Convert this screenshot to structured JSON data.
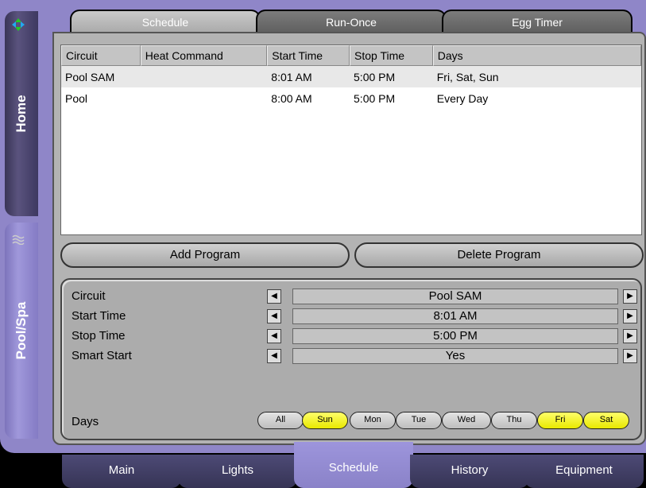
{
  "top_tabs": [
    {
      "label": "Schedule",
      "active": true
    },
    {
      "label": "Run-Once",
      "active": false
    },
    {
      "label": "Egg Timer",
      "active": false
    }
  ],
  "side_tabs": [
    {
      "label": "Home",
      "icon": "green-arrows-icon"
    },
    {
      "label": "Pool/Spa",
      "icon": "pool-icon"
    }
  ],
  "table": {
    "columns": [
      "Circuit",
      "Heat Command",
      "Start Time",
      "Stop Time",
      "Days"
    ],
    "rows": [
      {
        "circuit": "Pool SAM",
        "heat": "",
        "start": "8:01  AM",
        "stop": "5:00  PM",
        "days": "Fri, Sat, Sun",
        "selected": true
      },
      {
        "circuit": "Pool",
        "heat": "",
        "start": "8:00  AM",
        "stop": "5:00  PM",
        "days": "Every Day",
        "selected": false
      }
    ]
  },
  "buttons": {
    "add_program": "Add Program",
    "delete_program": "Delete Program"
  },
  "settings": {
    "circuit": {
      "label": "Circuit",
      "value": "Pool SAM"
    },
    "start_time": {
      "label": "Start Time",
      "value": "8:01  AM"
    },
    "stop_time": {
      "label": "Stop Time",
      "value": "5:00  PM"
    },
    "smart_start": {
      "label": "Smart Start",
      "value": "Yes"
    }
  },
  "days": {
    "label": "Days",
    "buttons": [
      {
        "label": "All",
        "on": false
      },
      {
        "label": "Sun",
        "on": true
      },
      {
        "label": "Mon",
        "on": false
      },
      {
        "label": "Tue",
        "on": false
      },
      {
        "label": "Wed",
        "on": false
      },
      {
        "label": "Thu",
        "on": false
      },
      {
        "label": "Fri",
        "on": true
      },
      {
        "label": "Sat",
        "on": true
      }
    ]
  },
  "bottom_nav": [
    {
      "label": "Main",
      "active": false
    },
    {
      "label": "Lights",
      "active": false
    },
    {
      "label": "Schedule",
      "active": true
    },
    {
      "label": "History",
      "active": false
    },
    {
      "label": "Equipment",
      "active": false
    }
  ],
  "colors": {
    "frame": "#8f86c8",
    "day_on": "#ffff00",
    "panel_gray": "#b3b3b3"
  }
}
